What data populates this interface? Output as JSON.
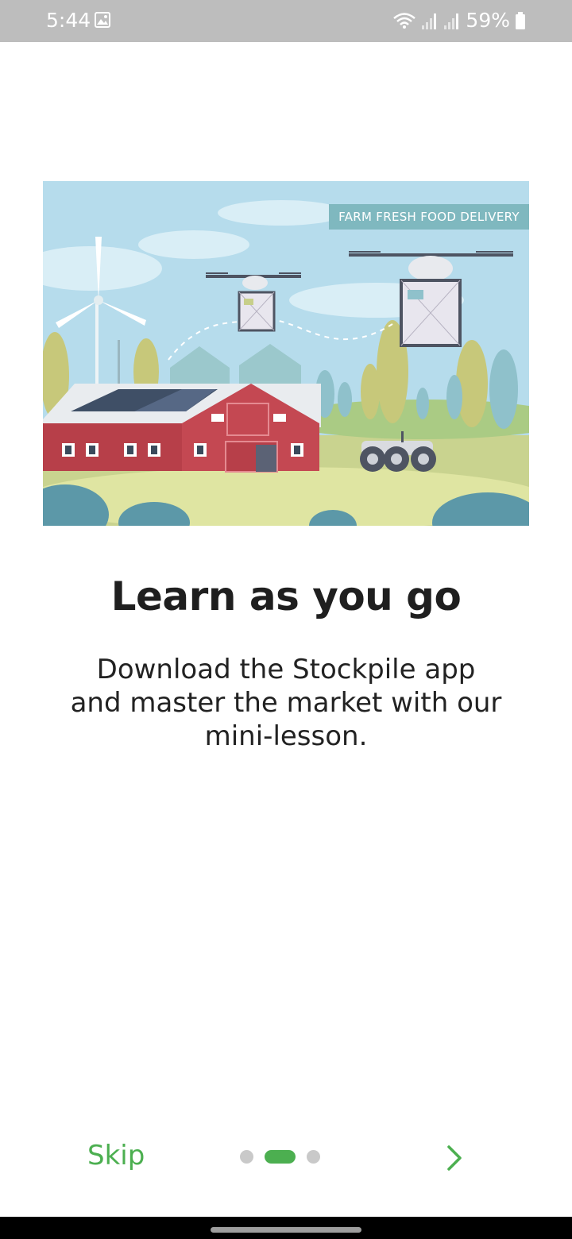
{
  "status_bar": {
    "time": "5:44",
    "battery": "59%",
    "icons": [
      "image-icon",
      "wifi-icon",
      "signal-icon",
      "signal-icon",
      "battery-icon"
    ]
  },
  "illustration": {
    "label": "FARM FRESH FOOD DELIVERY"
  },
  "onboarding": {
    "title": "Learn as you go",
    "description": "Download the Stockpile app and master the market with our mini-lesson."
  },
  "footer": {
    "skip_label": "Skip",
    "page_count": 3,
    "active_page": 2,
    "next_icon": "chevron-right-icon"
  },
  "colors": {
    "accent": "#4caf50",
    "status_bar": "#bdbdbd",
    "dot_inactive": "#c9c9c9",
    "label_bg": "#7fb8bf"
  }
}
